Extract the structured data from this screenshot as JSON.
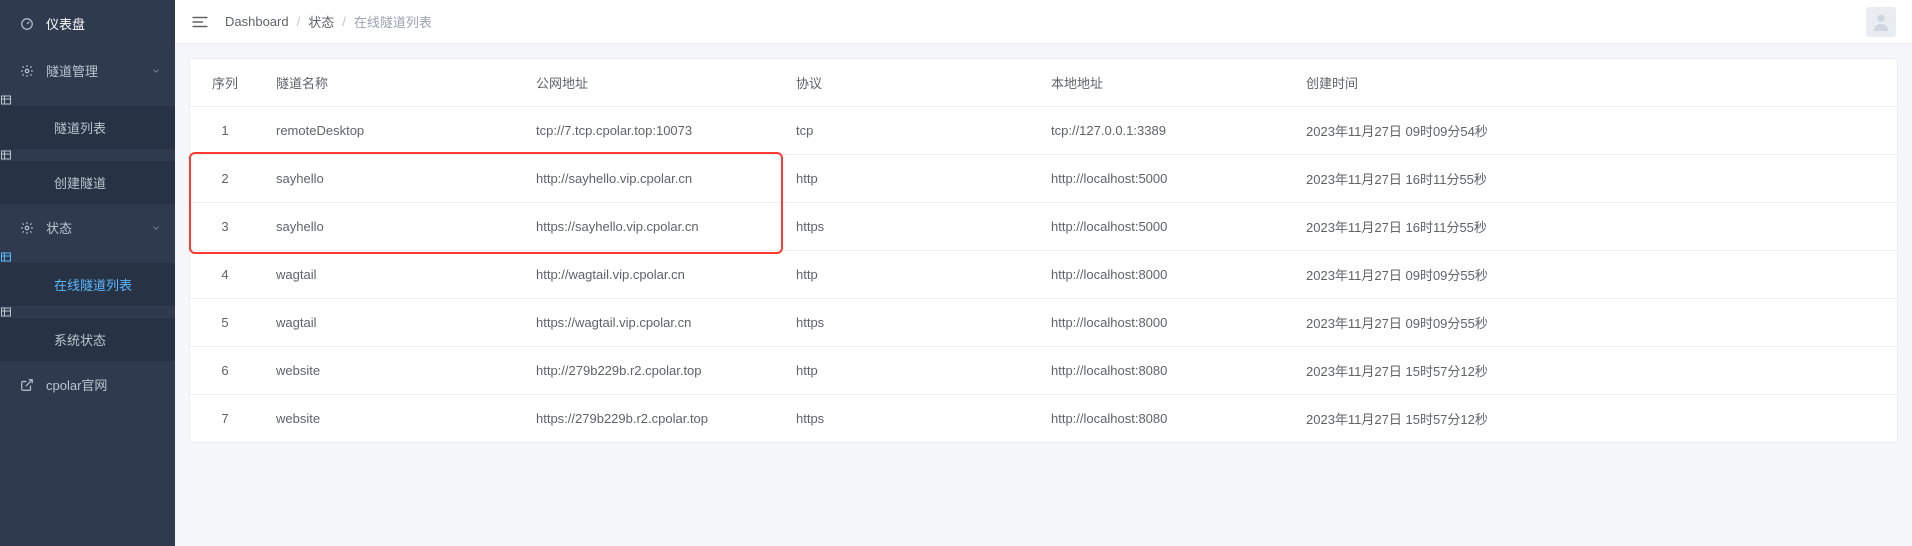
{
  "sidebar": {
    "dashboard": "仪表盘",
    "tunnel_mgmt": "隧道管理",
    "tunnel_list": "隧道列表",
    "tunnel_create": "创建隧道",
    "status": "状态",
    "online_tunnels": "在线隧道列表",
    "system_status": "系统状态",
    "cpolar_site": "cpolar官网"
  },
  "breadcrumb": {
    "dashboard": "Dashboard",
    "status": "状态",
    "current": "在线隧道列表"
  },
  "table": {
    "headers": {
      "seq": "序列",
      "name": "隧道名称",
      "url": "公网地址",
      "proto": "协议",
      "local": "本地地址",
      "created": "创建时间"
    },
    "rows": [
      {
        "seq": "1",
        "name": "remoteDesktop",
        "url": "tcp://7.tcp.cpolar.top:10073",
        "proto": "tcp",
        "local": "tcp://127.0.0.1:3389",
        "created": "2023年11月27日 09时09分54秒"
      },
      {
        "seq": "2",
        "name": "sayhello",
        "url": "http://sayhello.vip.cpolar.cn",
        "proto": "http",
        "local": "http://localhost:5000",
        "created": "2023年11月27日 16时11分55秒"
      },
      {
        "seq": "3",
        "name": "sayhello",
        "url": "https://sayhello.vip.cpolar.cn",
        "proto": "https",
        "local": "http://localhost:5000",
        "created": "2023年11月27日 16时11分55秒"
      },
      {
        "seq": "4",
        "name": "wagtail",
        "url": "http://wagtail.vip.cpolar.cn",
        "proto": "http",
        "local": "http://localhost:8000",
        "created": "2023年11月27日 09时09分55秒"
      },
      {
        "seq": "5",
        "name": "wagtail",
        "url": "https://wagtail.vip.cpolar.cn",
        "proto": "https",
        "local": "http://localhost:8000",
        "created": "2023年11月27日 09时09分55秒"
      },
      {
        "seq": "6",
        "name": "website",
        "url": "http://279b229b.r2.cpolar.top",
        "proto": "http",
        "local": "http://localhost:8080",
        "created": "2023年11月27日 15时57分12秒"
      },
      {
        "seq": "7",
        "name": "website",
        "url": "https://279b229b.r2.cpolar.top",
        "proto": "https",
        "local": "http://localhost:8080",
        "created": "2023年11月27日 15时57分12秒"
      }
    ]
  },
  "highlight_rows": [
    1,
    2
  ]
}
